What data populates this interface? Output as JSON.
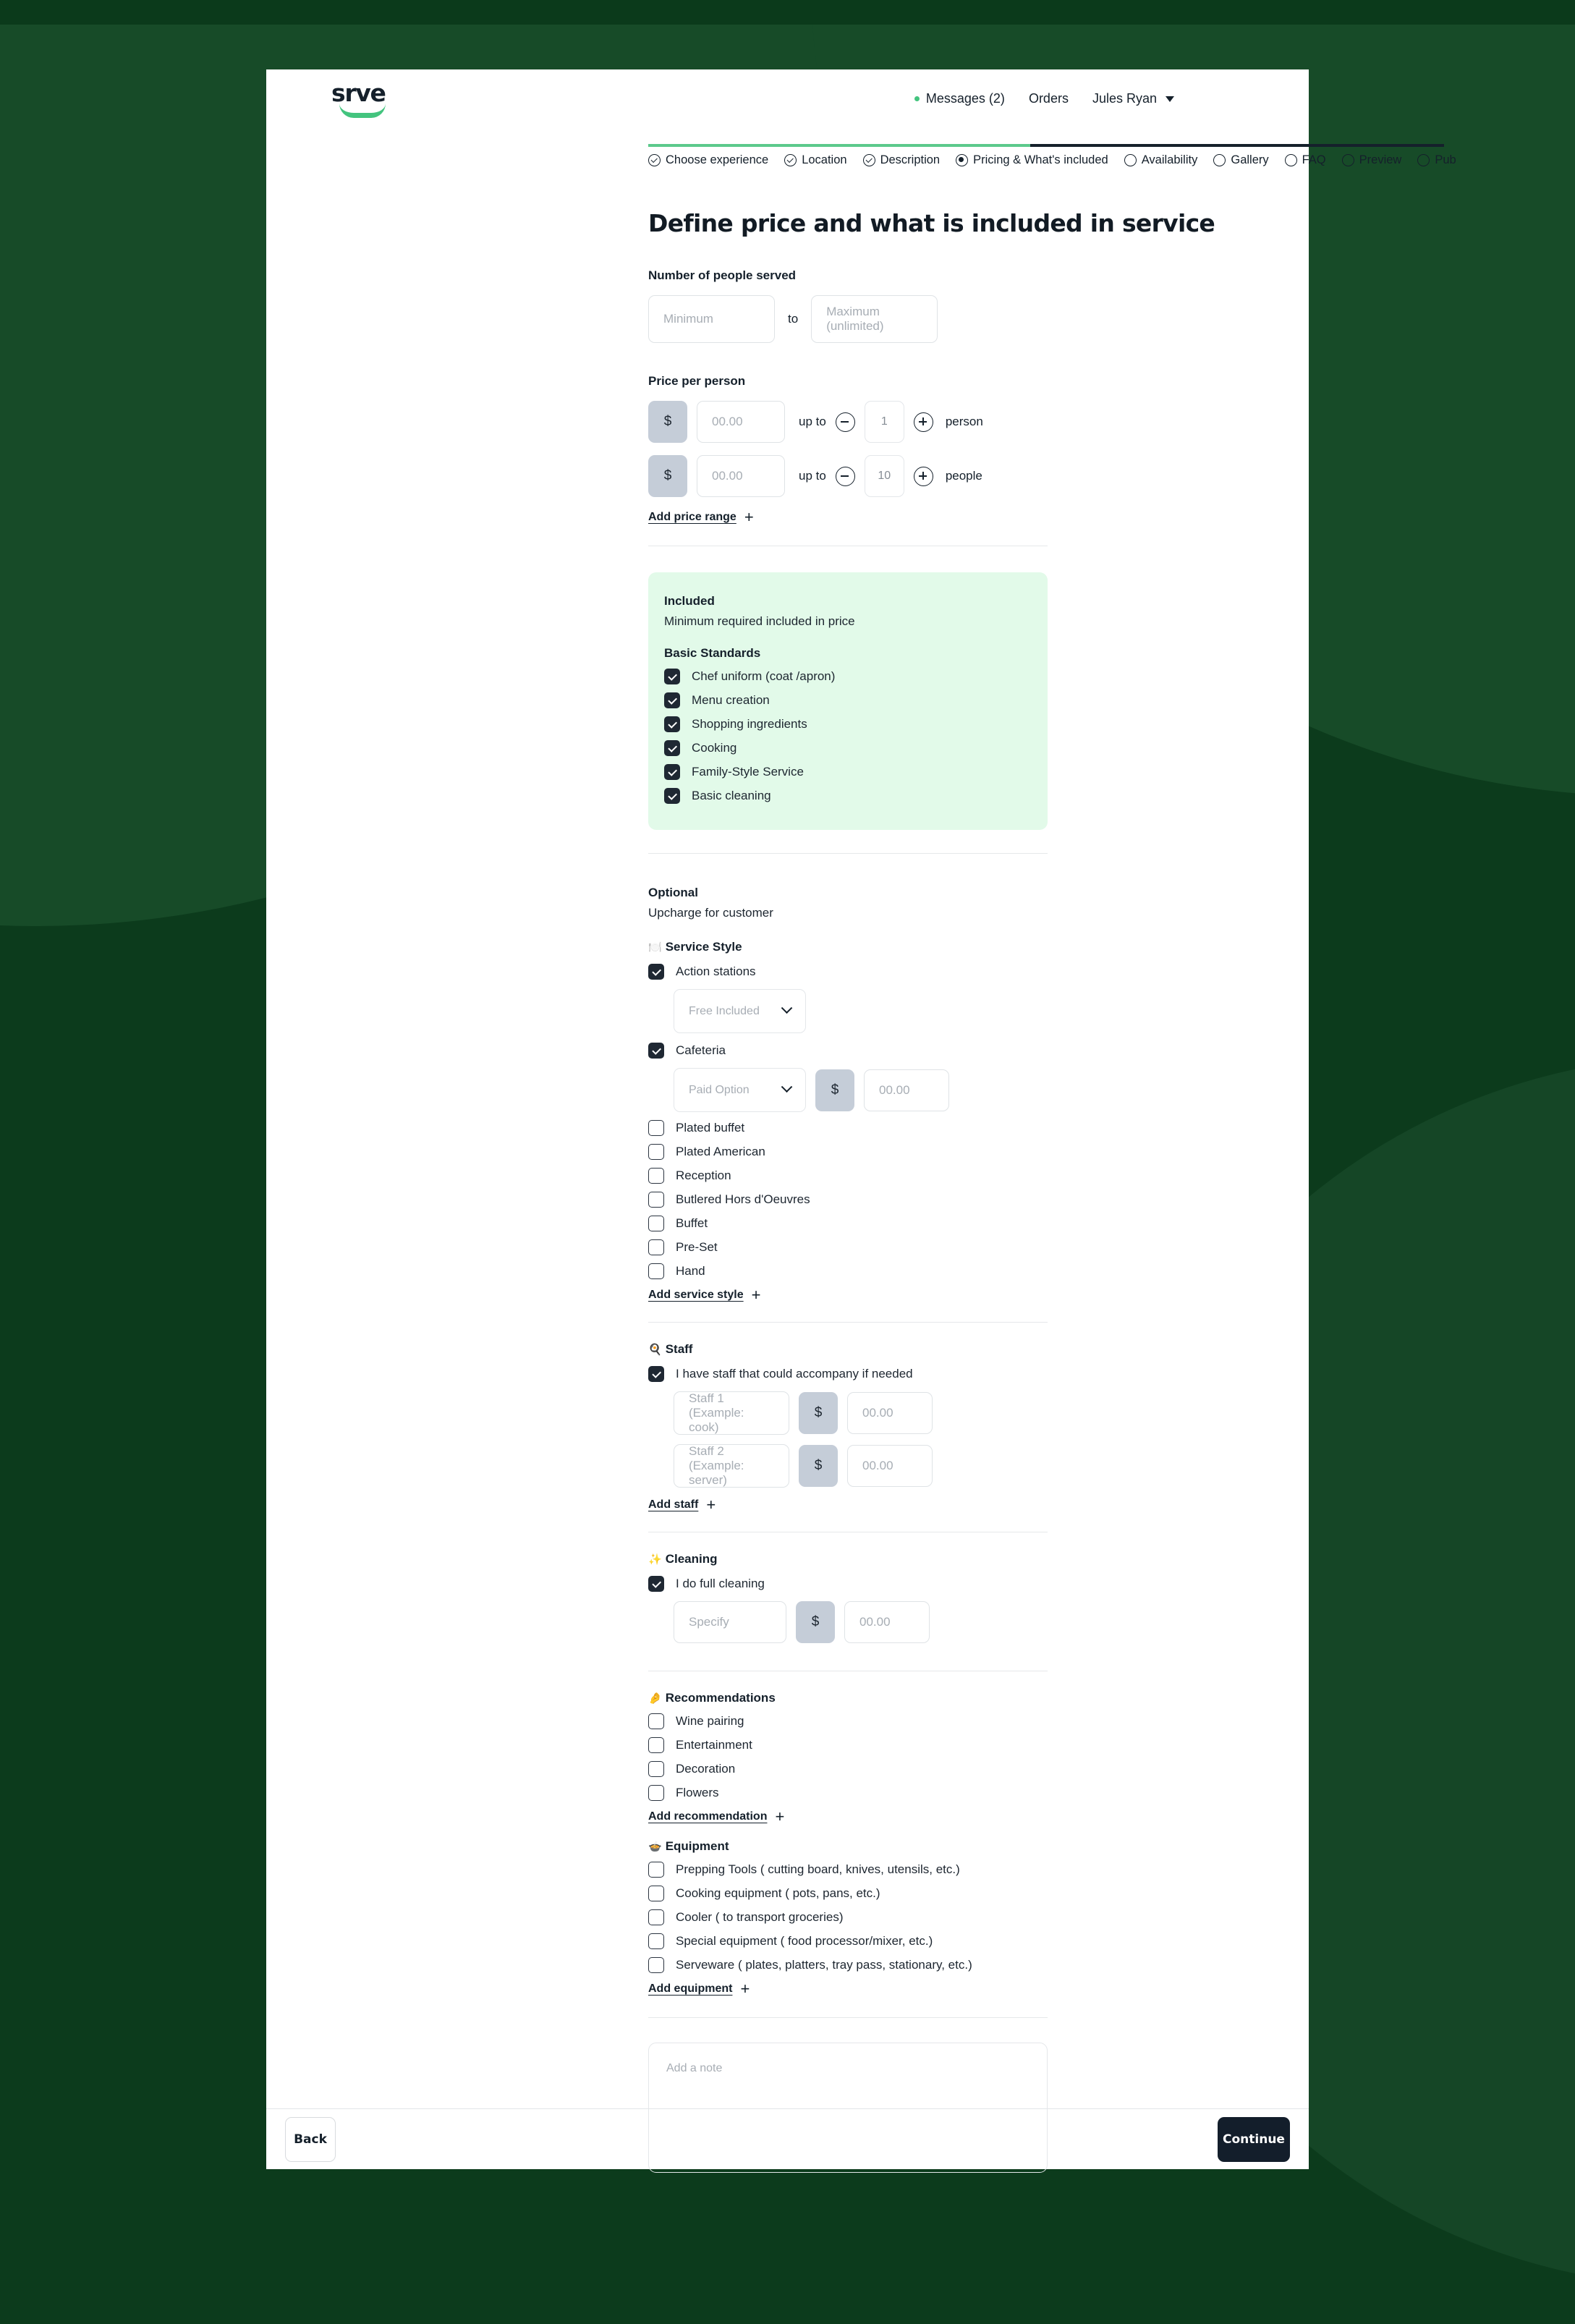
{
  "brand": {
    "wordmark": "srve"
  },
  "nav": {
    "messages": "Messages (2)",
    "orders": "Orders",
    "user": "Jules Ryan"
  },
  "stepper": {
    "steps": [
      {
        "label": "Choose experience",
        "state": "done"
      },
      {
        "label": "Location",
        "state": "done"
      },
      {
        "label": "Description",
        "state": "done"
      },
      {
        "label": "Pricing & What's included",
        "state": "current"
      },
      {
        "label": "Availability",
        "state": "todo"
      },
      {
        "label": "Gallery",
        "state": "todo"
      },
      {
        "label": "FAQ",
        "state": "todo"
      },
      {
        "label": "Preview",
        "state": "todo"
      },
      {
        "label": "Pub",
        "state": "todo"
      }
    ],
    "progress_color_done": "#5cc98c",
    "progress_color_todo": "#15202b"
  },
  "page": {
    "title": "Define price and what is included in service"
  },
  "people_served": {
    "label": "Number of people served",
    "min_placeholder": "Minimum",
    "to": "to",
    "max_placeholder": "Maximum (unlimited)"
  },
  "price_per_person": {
    "label": "Price per person",
    "rows": [
      {
        "currency": "$",
        "amount_placeholder": "00.00",
        "upto": "up to",
        "qty": "1",
        "unit": "person"
      },
      {
        "currency": "$",
        "amount_placeholder": "00.00",
        "upto": "up to",
        "qty": "10",
        "unit": "people"
      }
    ],
    "add_link": "Add price range"
  },
  "included": {
    "title": "Included",
    "subtitle": "Minimum required included in price",
    "group": "Basic Standards",
    "bg_color": "#e2fae9",
    "items": [
      {
        "label": "Chef uniform (coat /apron)",
        "checked": true
      },
      {
        "label": "Menu creation",
        "checked": true
      },
      {
        "label": "Shopping ingredients",
        "checked": true
      },
      {
        "label": "Cooking",
        "checked": true
      },
      {
        "label": "Family-Style Service",
        "checked": true
      },
      {
        "label": "Basic cleaning",
        "checked": true
      }
    ]
  },
  "optional": {
    "title": "Optional",
    "subtitle": "Upcharge for customer"
  },
  "service_style": {
    "icon": "plate-cutlery-icon",
    "emoji": "🍽️",
    "title": "Service Style",
    "action_stations": {
      "label": "Action stations",
      "checked": true,
      "select_value": "Free Included"
    },
    "cafeteria": {
      "label": "Cafeteria",
      "checked": true,
      "select_value": "Paid Option",
      "currency": "$",
      "amount_placeholder": "00.00"
    },
    "options": [
      {
        "label": "Plated buffet",
        "checked": false
      },
      {
        "label": "Plated American",
        "checked": false
      },
      {
        "label": "Reception",
        "checked": false
      },
      {
        "label": "Butlered Hors d'Oeuvres",
        "checked": false
      },
      {
        "label": "Buffet",
        "checked": false
      },
      {
        "label": "Pre-Set",
        "checked": false
      },
      {
        "label": "Hand",
        "checked": false
      }
    ],
    "add_link": "Add service style"
  },
  "staff": {
    "icon": "frying-pan-icon",
    "emoji": "🍳",
    "title": "Staff",
    "checkbox_label": "I have staff that could accompany if needed",
    "checked": true,
    "rows": [
      {
        "name_placeholder": "Staff 1 (Example: cook)",
        "currency": "$",
        "amount_placeholder": "00.00"
      },
      {
        "name_placeholder": "Staff 2 (Example: server)",
        "currency": "$",
        "amount_placeholder": "00.00"
      }
    ],
    "add_link": "Add staff"
  },
  "cleaning": {
    "icon": "sparkles-icon",
    "emoji": "✨",
    "title": "Cleaning",
    "checkbox_label": "I do full cleaning",
    "checked": true,
    "specify_placeholder": "Specify",
    "currency": "$",
    "amount_placeholder": "00.00"
  },
  "recommendations": {
    "icon": "pinched-fingers-icon",
    "emoji": "🤌",
    "title": "Recommendations",
    "items": [
      {
        "label": "Wine pairing",
        "checked": false
      },
      {
        "label": "Entertainment",
        "checked": false
      },
      {
        "label": "Decoration",
        "checked": false
      },
      {
        "label": "Flowers",
        "checked": false
      }
    ],
    "add_link": "Add recommendation"
  },
  "equipment": {
    "icon": "cooking-pot-icon",
    "emoji": "🍲",
    "title": "Equipment",
    "items": [
      {
        "label": "Prepping Tools ( cutting board, knives, utensils, etc.)",
        "checked": false
      },
      {
        "label": "Cooking equipment ( pots, pans, etc.)",
        "checked": false
      },
      {
        "label": "Cooler ( to transport groceries)",
        "checked": false
      },
      {
        "label": "Special equipment ( food processor/mixer, etc.)",
        "checked": false
      },
      {
        "label": "Serveware ( plates, platters, tray pass, stationary, etc.)",
        "checked": false
      }
    ],
    "add_link": "Add equipment"
  },
  "note": {
    "placeholder": "Add a note"
  },
  "footer": {
    "back": "Back",
    "continue": "Continue"
  }
}
